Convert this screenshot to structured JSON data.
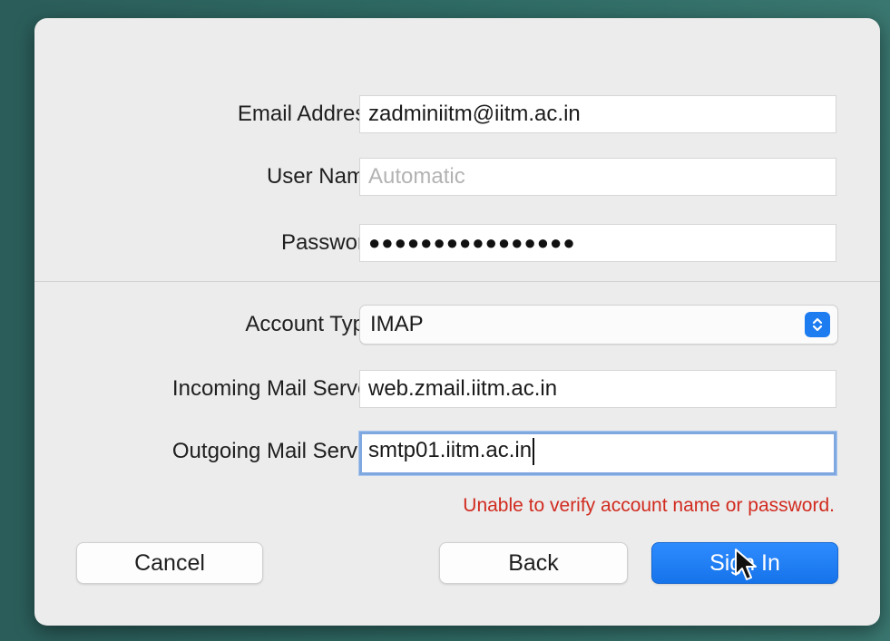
{
  "form": {
    "email_label": "Email Address:",
    "email_value": "zadminiitm@iitm.ac.in",
    "username_label": "User Name:",
    "username_placeholder": "Automatic",
    "password_label": "Password:",
    "password_value": "●●●●●●●●●●●●●●●●",
    "account_type_label": "Account Type:",
    "account_type_value": "IMAP",
    "incoming_label": "Incoming Mail Server:",
    "incoming_value": "web.zmail.iitm.ac.in",
    "outgoing_label": "Outgoing Mail Server:",
    "outgoing_value": "smtp01.iitm.ac.in"
  },
  "error_message": "Unable to verify account name or password.",
  "buttons": {
    "cancel": "Cancel",
    "back": "Back",
    "sign_in": "Sign In"
  },
  "icons": {
    "stepper": "chevron-up-down-icon",
    "cursor": "mouse-pointer-icon"
  },
  "colors": {
    "accent": "#1c7cf0",
    "error": "#d12b1f"
  }
}
